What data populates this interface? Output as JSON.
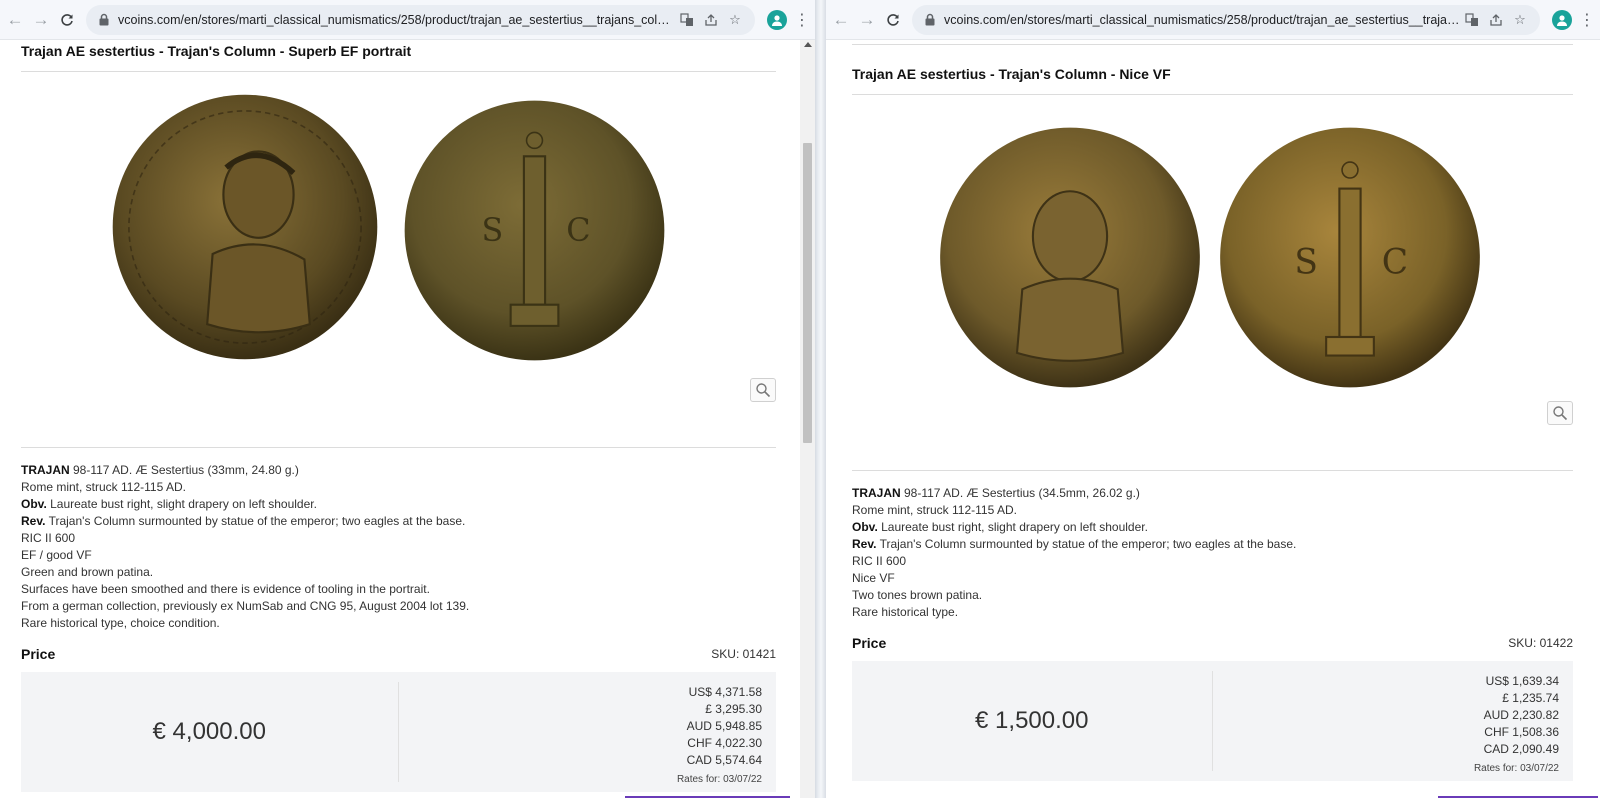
{
  "left": {
    "url": "vcoins.com/en/stores/marti_classical_numismatics/258/product/trajan_ae_sestertius__trajans_column__...",
    "title": "Trajan AE sestertius - Trajan's Column - Superb EF portrait",
    "desc": {
      "l1_bold": "TRAJAN",
      "l1_rest": " 98-117 AD. Æ Sestertius (33mm, 24.80 g.)",
      "l2": "Rome mint, struck 112-115 AD.",
      "l3_bold": "Obv.",
      "l3_rest": " Laureate bust right, slight drapery on left shoulder.",
      "l4_bold": "Rev.",
      "l4_rest": " Trajan's Column surmounted by statue of the emperor; two eagles at the base.",
      "l5": "RIC II 600",
      "l6": "EF / good VF",
      "l7": "Green and brown patina.",
      "l8": "Surfaces have been smoothed and there is evidence of tooling in the portrait.",
      "l9": "From a german collection, previously ex NumSab and CNG 95, August 2004 lot 139.",
      "l10": "Rare historical type, choice condition."
    },
    "price_label": "Price",
    "sku": "SKU: 01421",
    "price": "€ 4,000.00",
    "rates": [
      "US$ 4,371.58",
      "£ 3,295.30",
      "AUD 5,948.85",
      "CHF 4,022.30",
      "CAD 5,574.64"
    ],
    "rates_date": "Rates for: 03/07/22",
    "coin_colors": {
      "obverse": "#5a4a22",
      "reverse": "#5e5228"
    }
  },
  "right": {
    "url": "vcoins.com/en/stores/marti_classical_numismatics/258/product/trajan_ae_sestertius__trajans_col...",
    "title": "Trajan AE sestertius - Trajan's Column - Nice VF",
    "desc": {
      "l1_bold": "TRAJAN",
      "l1_rest": " 98-117 AD. Æ Sestertius (34.5mm, 26.02 g.)",
      "l2": "Rome mint, struck 112-115 AD.",
      "l3_bold": "Obv.",
      "l3_rest": " Laureate bust right, slight drapery on left shoulder.",
      "l4_bold": "Rev.",
      "l4_rest": " Trajan's Column surmounted by statue of the emperor; two eagles at the base.",
      "l5": "RIC II 600",
      "l6": "Nice VF",
      "l7": "Two tones brown patina.",
      "l8": "Rare historical type."
    },
    "price_label": "Price",
    "sku": "SKU: 01422",
    "price": "€ 1,500.00",
    "rates": [
      "US$ 1,639.34",
      "£ 1,235.74",
      "AUD 2,230.82",
      "CHF 1,508.36",
      "CAD 2,090.49"
    ],
    "rates_date": "Rates for: 03/07/22",
    "coin_colors": {
      "obverse": "#6e5a2a",
      "reverse": "#7a6228"
    }
  },
  "icons": {
    "back": "arrow-left-icon",
    "forward": "arrow-right-icon",
    "reload": "reload-icon",
    "lock": "lock-icon",
    "translate": "translate-icon",
    "share": "share-icon",
    "bookmark": "star-icon",
    "profile": "avatar",
    "menu": "kebab-menu-icon",
    "zoom": "magnifier-icon"
  }
}
